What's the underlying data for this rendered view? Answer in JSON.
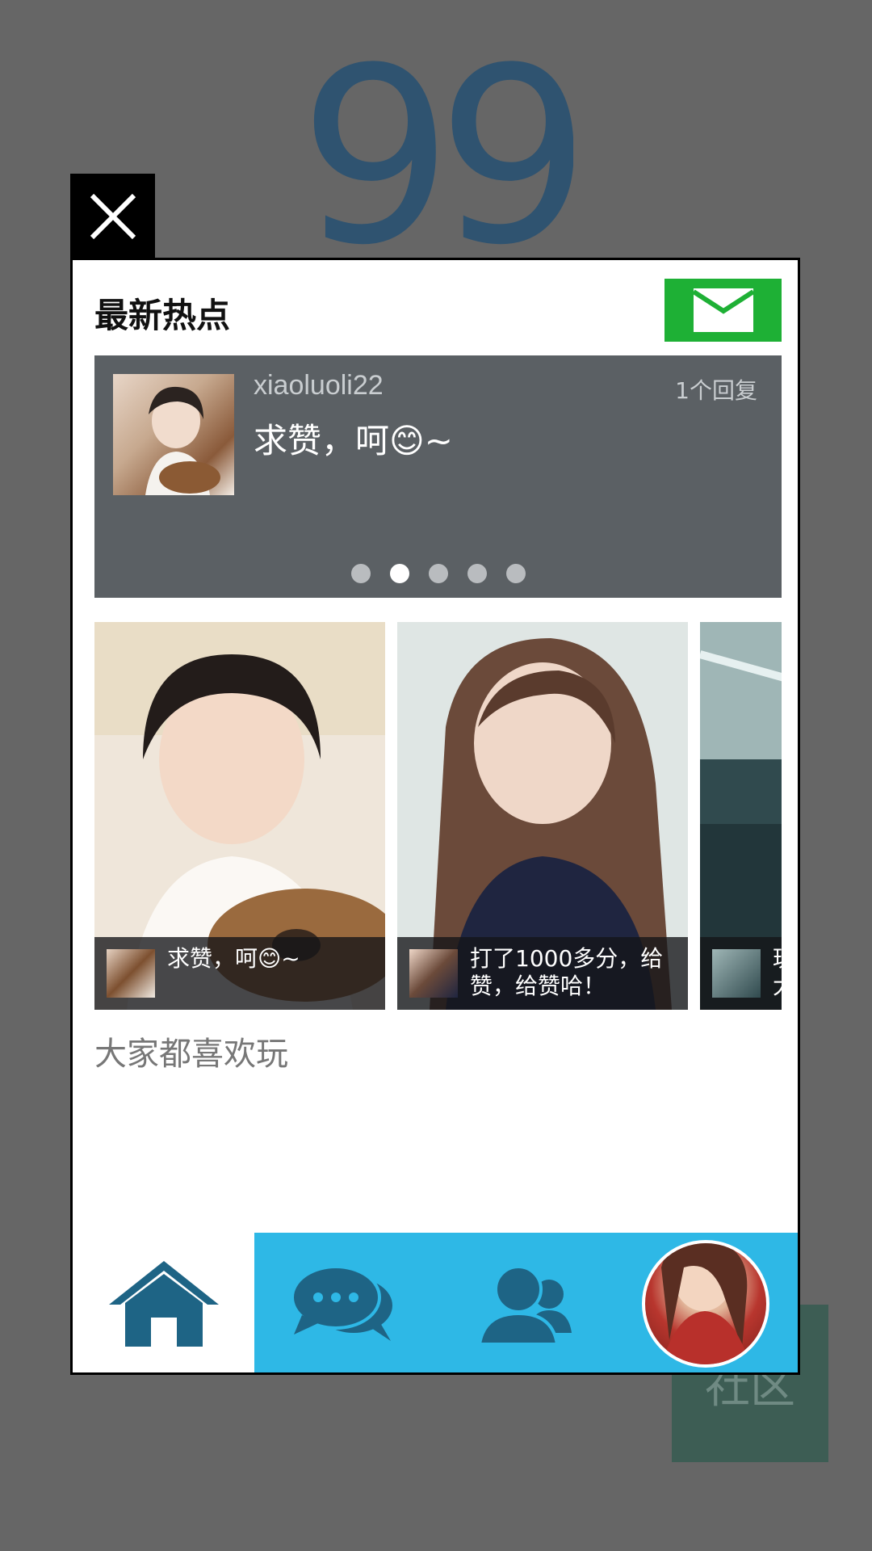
{
  "background": {
    "score": "99",
    "community_label": "社区"
  },
  "panel": {
    "title": "最新热点"
  },
  "hot_post": {
    "username": "xiaoluoli22",
    "reply_count": "1个回复",
    "text": "求赞，呵😊~",
    "carousel_pages": 5,
    "carousel_active_index": 1
  },
  "gallery": [
    {
      "caption": "求赞，呵😊~"
    },
    {
      "caption": "打了1000多分，给赞，给赞哈！"
    },
    {
      "caption": "玩大"
    }
  ],
  "section": {
    "title": "大家都喜欢玩"
  },
  "bottom_nav": {
    "tabs": [
      "home",
      "messages",
      "friends",
      "profile"
    ],
    "active": "home"
  },
  "colors": {
    "page_bg": "#666666",
    "mail_button": "#1eb035",
    "nav_bar": "#2eb8e6",
    "nav_icon": "#1e6485",
    "hot_card": "#5b6064"
  },
  "icons": {
    "close": "close-icon",
    "mail": "mail-icon",
    "home": "home-icon",
    "messages": "chat-bubbles-icon",
    "friends": "users-icon"
  }
}
